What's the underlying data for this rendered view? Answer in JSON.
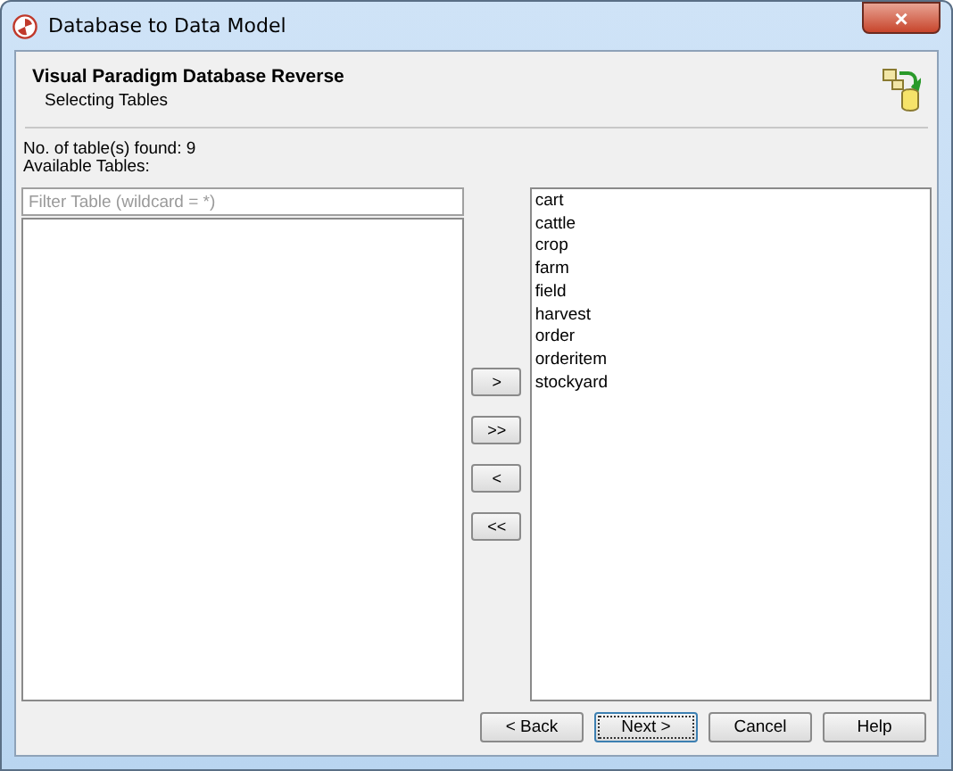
{
  "window": {
    "title": "Database to Data Model",
    "close": "×"
  },
  "header": {
    "title": "Visual Paradigm Database Reverse",
    "subtitle": "Selecting Tables"
  },
  "found_label": "No. of table(s) found: 9",
  "available_label": "Available Tables:",
  "filter": {
    "placeholder": "Filter Table (wildcard = *)"
  },
  "selected_tables": [
    "cart",
    "cattle",
    "crop",
    "farm",
    "field",
    "harvest",
    "order",
    "orderitem",
    "stockyard"
  ],
  "move_buttons": [
    {
      "label": ">"
    },
    {
      "label": ">>"
    },
    {
      "label": "<"
    },
    {
      "label": "<<"
    }
  ],
  "nav_buttons": [
    {
      "label": "< Back",
      "focused": false
    },
    {
      "label": "Next >",
      "focused": true
    },
    {
      "label": "Cancel",
      "focused": false
    },
    {
      "label": "Help",
      "focused": false
    }
  ]
}
